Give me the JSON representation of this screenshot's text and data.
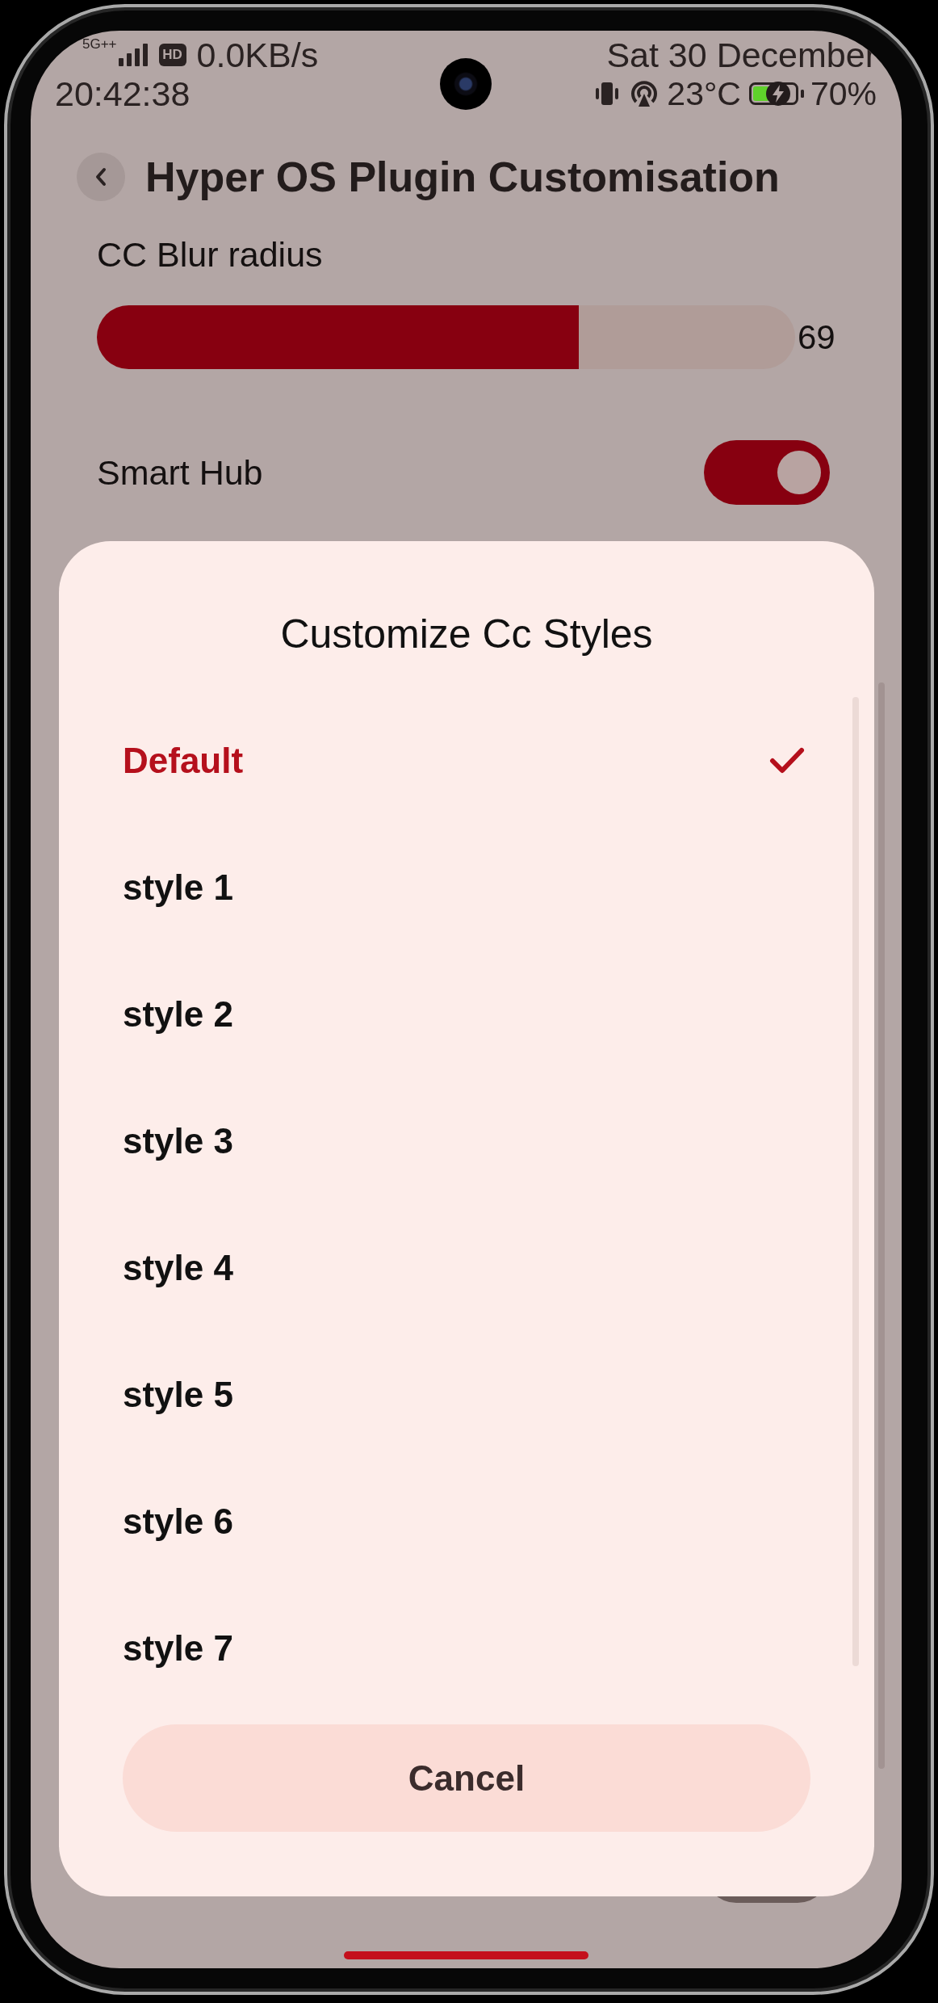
{
  "status_bar": {
    "network_type": "5G++",
    "hd_badge": "HD",
    "speed": "0.0KB/s",
    "time": "20:42:38",
    "date": "Sat 30 December",
    "temperature": "23°C",
    "battery": "70%"
  },
  "header": {
    "title": "Hyper OS Plugin Customisation"
  },
  "settings": [
    {
      "kind": "slider",
      "label": "CC Blur radius",
      "level": 0.69,
      "reading": "69"
    },
    {
      "kind": "switch",
      "label": "Smart Hub",
      "on": true
    },
    {
      "kind": "switch",
      "on": false
    }
  ],
  "dialog": {
    "title": "Customize Cc Styles",
    "options": [
      {
        "label": "Default",
        "selected": true
      },
      {
        "label": "style 1",
        "selected": false
      },
      {
        "label": "style 2",
        "selected": false
      },
      {
        "label": "style 3",
        "selected": false
      },
      {
        "label": "style 4",
        "selected": false
      },
      {
        "label": "style 5",
        "selected": false
      },
      {
        "label": "style 6",
        "selected": false
      },
      {
        "label": "style 7",
        "selected": false
      }
    ],
    "cancel_button": "Cancel"
  }
}
